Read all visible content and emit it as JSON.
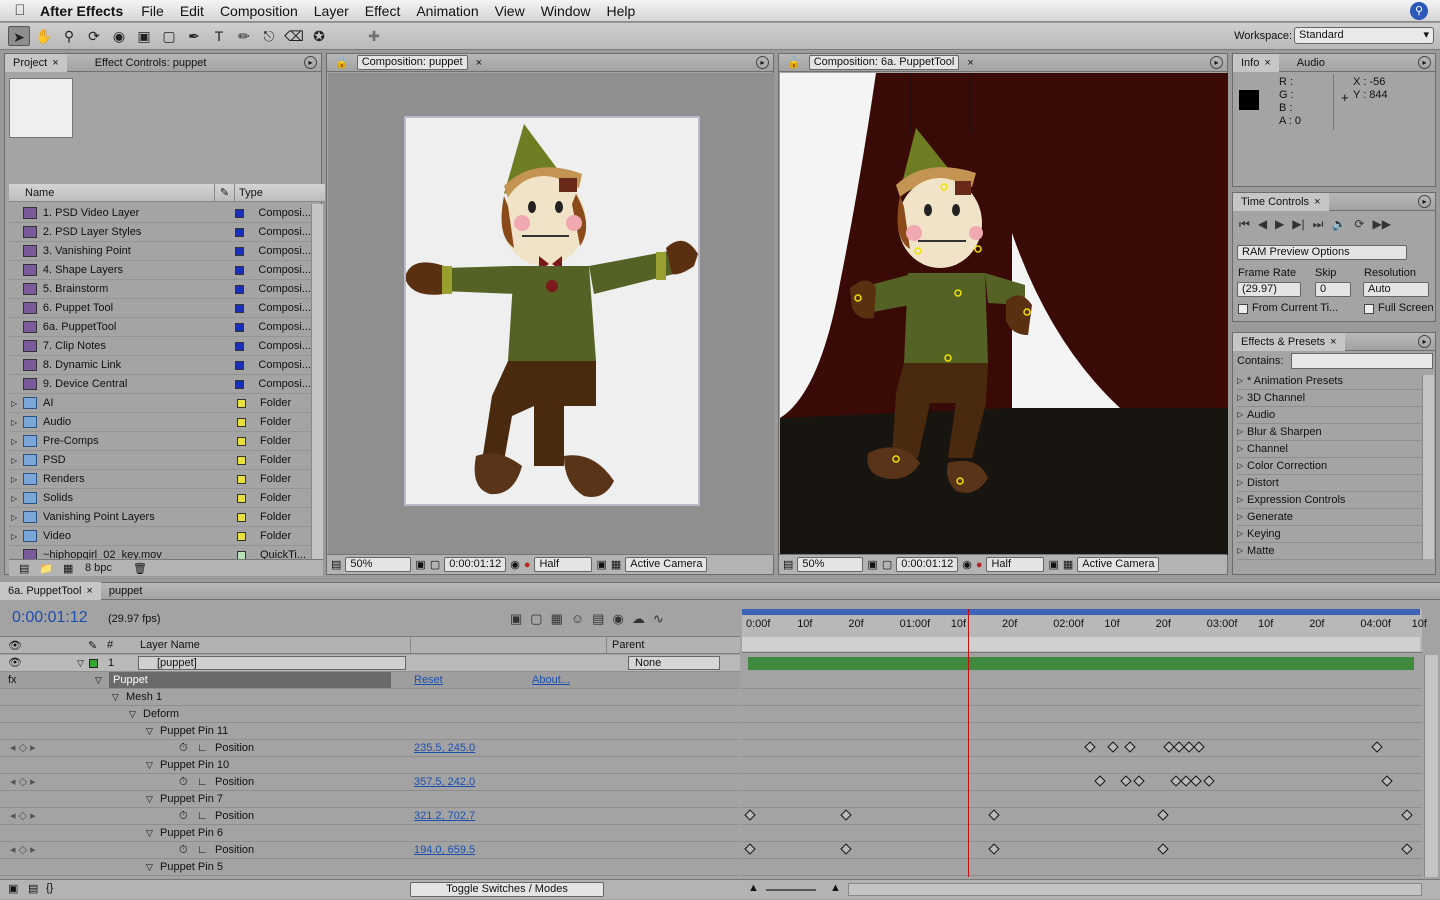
{
  "menubar": {
    "app": "After Effects",
    "items": [
      "File",
      "Edit",
      "Composition",
      "Layer",
      "Effect",
      "Animation",
      "View",
      "Window",
      "Help"
    ]
  },
  "toolbar": {
    "workspace_label": "Workspace:",
    "workspace_value": "Standard"
  },
  "project": {
    "tabs": [
      "Project",
      "Effect Controls: puppet"
    ],
    "columns": {
      "name": "Name",
      "type": "Type"
    },
    "items": [
      {
        "name": "1. PSD Video Layer",
        "type": "Composi...",
        "kind": "comp"
      },
      {
        "name": "2. PSD Layer Styles",
        "type": "Composi...",
        "kind": "comp"
      },
      {
        "name": "3. Vanishing Point",
        "type": "Composi...",
        "kind": "comp"
      },
      {
        "name": "4. Shape Layers",
        "type": "Composi...",
        "kind": "comp"
      },
      {
        "name": "5. Brainstorm",
        "type": "Composi...",
        "kind": "comp"
      },
      {
        "name": "6. Puppet Tool",
        "type": "Composi...",
        "kind": "comp"
      },
      {
        "name": "6a. PuppetTool",
        "type": "Composi...",
        "kind": "comp"
      },
      {
        "name": "7. Clip Notes",
        "type": "Composi...",
        "kind": "comp"
      },
      {
        "name": "8. Dynamic Link",
        "type": "Composi...",
        "kind": "comp"
      },
      {
        "name": "9. Device Central",
        "type": "Composi...",
        "kind": "comp"
      },
      {
        "name": "AI",
        "type": "Folder",
        "kind": "folder"
      },
      {
        "name": "Audio",
        "type": "Folder",
        "kind": "folder"
      },
      {
        "name": "Pre-Comps",
        "type": "Folder",
        "kind": "folder"
      },
      {
        "name": "PSD",
        "type": "Folder",
        "kind": "folder"
      },
      {
        "name": "Renders",
        "type": "Folder",
        "kind": "folder"
      },
      {
        "name": "Solids",
        "type": "Folder",
        "kind": "folder"
      },
      {
        "name": "Vanishing Point Layers",
        "type": "Folder",
        "kind": "folder"
      },
      {
        "name": "Video",
        "type": "Folder",
        "kind": "folder"
      },
      {
        "name": "~hiphopgirl_02_key.mov",
        "type": "QuickTi...",
        "kind": "file"
      }
    ],
    "bpc": "8 bpc"
  },
  "comp1": {
    "tab": "Composition: puppet",
    "zoom": "50%",
    "time": "0:00:01:12",
    "resolution": "Half",
    "camera": "Active Camera"
  },
  "comp2": {
    "tab": "Composition: 6a. PuppetTool",
    "zoom": "50%",
    "time": "0:00:01:12",
    "resolution": "Half",
    "camera": "Active Camera"
  },
  "info": {
    "tabs": [
      "Info",
      "Audio"
    ],
    "r": "R :",
    "g": "G :",
    "b": "B :",
    "a": "A : 0",
    "x": "X : -56",
    "y": "Y : 844"
  },
  "time_controls": {
    "tab": "Time Controls",
    "ram_preview": "RAM Preview Options",
    "frame_rate_label": "Frame Rate",
    "skip_label": "Skip",
    "resolution_label": "Resolution",
    "frame_rate": "(29.97)",
    "skip": "0",
    "resolution": "Auto",
    "from_current": "From Current Ti...",
    "full_screen": "Full Screen"
  },
  "effects": {
    "tab": "Effects & Presets",
    "contains_label": "Contains:",
    "items": [
      "* Animation Presets",
      "3D Channel",
      "Audio",
      "Blur & Sharpen",
      "Channel",
      "Color Correction",
      "Distort",
      "Expression Controls",
      "Generate",
      "Keying",
      "Matte"
    ]
  },
  "timeline": {
    "tabs": [
      "6a. PuppetTool",
      "puppet"
    ],
    "timecode": "0:00:01:12",
    "fps": "(29.97 fps)",
    "col_layer_name": "Layer Name",
    "col_parent": "Parent",
    "col_num": "#",
    "layer": {
      "num": "1",
      "name": "[puppet]",
      "parent": "None"
    },
    "ruler": [
      "0:00f",
      "10f",
      "20f",
      "01:00f",
      "10f",
      "20f",
      "02:00f",
      "10f",
      "20f",
      "03:00f",
      "10f",
      "20f",
      "04:00f",
      "10f"
    ],
    "rows": [
      {
        "indent": 1,
        "label": "Puppet",
        "reset": "Reset",
        "about": "About..."
      },
      {
        "indent": 2,
        "label": "Mesh 1"
      },
      {
        "indent": 3,
        "label": "Deform"
      },
      {
        "indent": 4,
        "label": "Puppet Pin 11"
      },
      {
        "indent": 5,
        "label": "Position",
        "value": "235.5, 245.0",
        "kf": [
          0.515,
          0.55,
          0.575,
          0.635,
          0.65,
          0.665,
          0.68,
          0.95
        ]
      },
      {
        "indent": 4,
        "label": "Puppet Pin 10"
      },
      {
        "indent": 5,
        "label": "Position",
        "value": "357.5, 242.0",
        "kf": [
          0.53,
          0.57,
          0.59,
          0.645,
          0.66,
          0.675,
          0.695,
          0.965
        ]
      },
      {
        "indent": 4,
        "label": "Puppet Pin 7"
      },
      {
        "indent": 5,
        "label": "Position",
        "value": "321.2, 702.7",
        "kf": [
          0.0,
          0.145,
          0.37,
          0.625,
          0.995
        ]
      },
      {
        "indent": 4,
        "label": "Puppet Pin 6"
      },
      {
        "indent": 5,
        "label": "Position",
        "value": "194.0, 659.5",
        "kf": [
          0.0,
          0.145,
          0.37,
          0.625,
          0.995
        ]
      },
      {
        "indent": 4,
        "label": "Puppet Pin 5"
      }
    ],
    "toggle": "Toggle Switches / Modes",
    "current_time": 0.33
  }
}
